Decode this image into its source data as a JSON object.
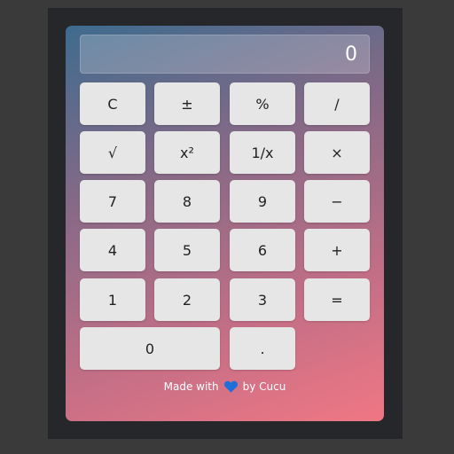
{
  "display": {
    "value": "0"
  },
  "keys": {
    "clear": "C",
    "negate": "±",
    "percent": "%",
    "divide": "/",
    "sqrt": "√",
    "square": "x²",
    "reciprocal": "1/x",
    "multiply": "×",
    "seven": "7",
    "eight": "8",
    "nine": "9",
    "subtract": "−",
    "four": "4",
    "five": "5",
    "six": "6",
    "add": "+",
    "one": "1",
    "two": "2",
    "three": "3",
    "equals": "=",
    "zero": "0",
    "decimal": "."
  },
  "footer": {
    "made_with": "Made with",
    "heart_icon": "heart-icon",
    "by": "by Cucu"
  },
  "colors": {
    "gradient_start": "#3e6b8e",
    "gradient_end": "#f07784",
    "key_bg": "#e6e6e6",
    "heart": "#1e6fd9"
  }
}
